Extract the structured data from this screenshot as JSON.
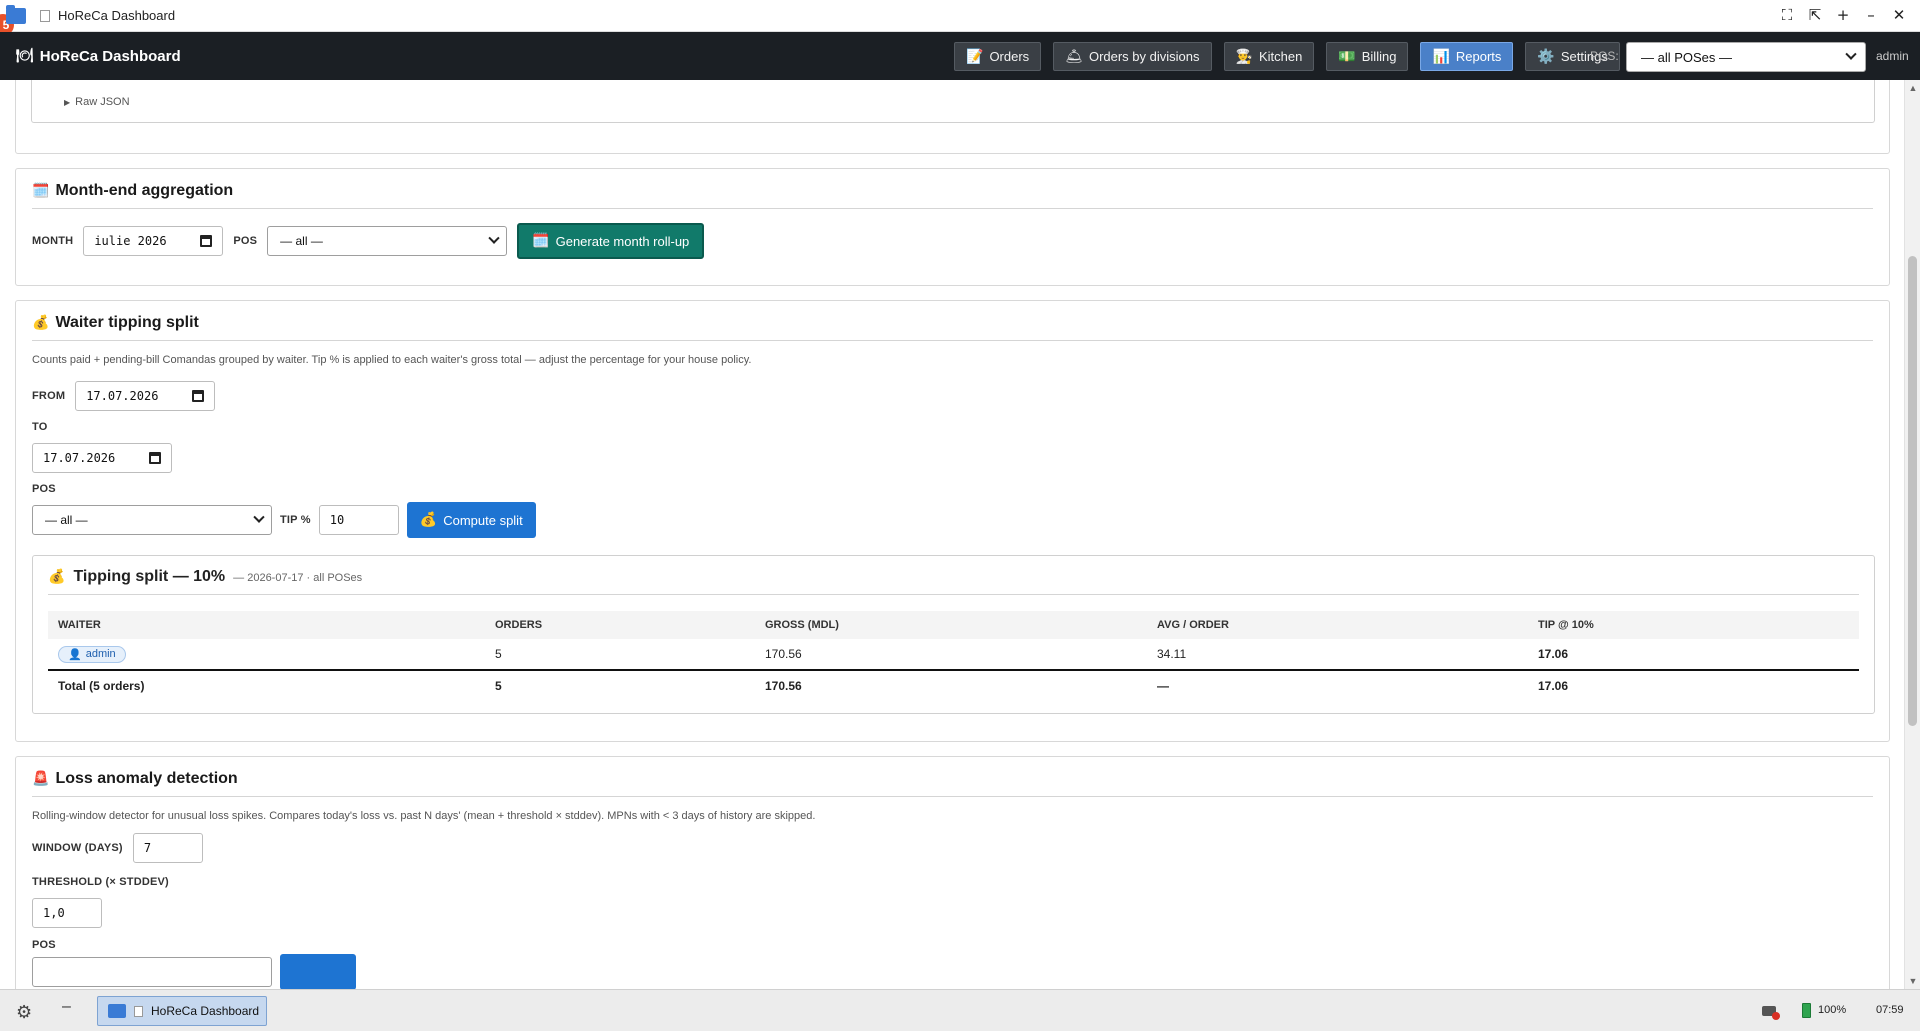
{
  "window": {
    "badge": "5",
    "title": "HoReCa Dashboard",
    "controls": [
      "⛶",
      "⇱",
      "+",
      "–",
      "✕"
    ]
  },
  "nav": {
    "brand": "HoReCa Dashboard",
    "brand_icon": "🍽",
    "buttons": [
      {
        "icon": "📝",
        "label": "Orders"
      },
      {
        "icon": "🛎",
        "label": "Orders by divisions"
      },
      {
        "icon": "👨‍🍳",
        "label": "Kitchen"
      },
      {
        "icon": "💵",
        "label": "Billing"
      },
      {
        "icon": "📊",
        "label": "Reports"
      },
      {
        "icon": "⚙️",
        "label": "Settings"
      }
    ],
    "active": "Reports",
    "pos_label": "POS:",
    "pos_value": "— all POSes —",
    "user": "admin"
  },
  "raw_json": {
    "label": "Raw JSON",
    "icon": "▶"
  },
  "month_end": {
    "icon": "🗓️",
    "title": "Month-end aggregation",
    "month_label": "MONTH",
    "month_value": "iulie 2026",
    "pos_label": "POS",
    "pos_value": "— all —",
    "button": "Generate month roll-up",
    "button_icon": "🗓️"
  },
  "tipping": {
    "icon": "💰",
    "title": "Waiter tipping split",
    "description": "Counts paid + pending-bill Comandas grouped by waiter. Tip % is applied to each waiter's gross total — adjust the percentage for your house policy.",
    "from_label": "FROM",
    "from_value": "17.07.2026",
    "to_label": "TO",
    "to_value": "17.07.2026",
    "pos_label": "POS",
    "pos_value": "— all —",
    "tip_label": "TIP %",
    "tip_value": "10",
    "button": "Compute split",
    "button_icon": "💰",
    "result": {
      "icon": "💰",
      "title": "Tipping split — 10%",
      "subtitle": "— 2026-07-17 · all POSes",
      "columns": [
        "WAITER",
        "ORDERS",
        "GROSS (MDL)",
        "AVG / ORDER",
        "TIP @ 10%"
      ],
      "rows": [
        {
          "waiter": "admin",
          "waiter_icon": "👤",
          "orders": "5",
          "gross": "170.56",
          "avg": "34.11",
          "tip": "17.06"
        }
      ],
      "total": {
        "label": "Total (5 orders)",
        "orders": "5",
        "gross": "170.56",
        "avg": "—",
        "tip": "17.06"
      }
    }
  },
  "loss": {
    "icon": "🚨",
    "title": "Loss anomaly detection",
    "description": "Rolling-window detector for unusual loss spikes. Compares today's loss vs. past N days' (mean + threshold × stddev). MPNs with < 3 days of history are skipped.",
    "window_label": "WINDOW (DAYS)",
    "window_value": "7",
    "threshold_label": "THRESHOLD (× STDDEV)",
    "threshold_value": "1,0",
    "pos_label": "POS"
  },
  "taskbar": {
    "item": "HoReCa Dashboard",
    "battery": "100%",
    "time": "07:59"
  }
}
